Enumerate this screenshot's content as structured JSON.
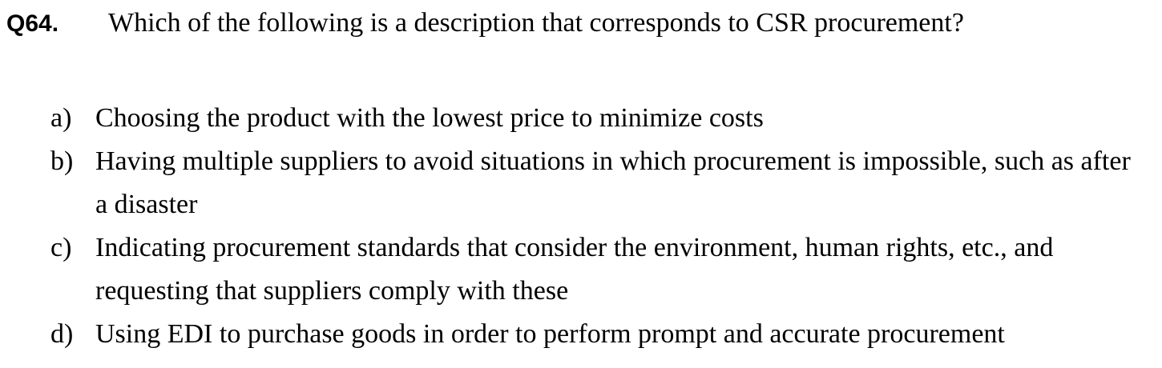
{
  "question": {
    "number": "Q64.",
    "text": "Which of the following is a description that corresponds to CSR procurement?"
  },
  "options": [
    {
      "letter": "a)",
      "text": "Choosing the product with the lowest price to minimize costs"
    },
    {
      "letter": "b)",
      "text": "Having multiple suppliers to avoid situations in which procurement is impossible, such as after a disaster"
    },
    {
      "letter": "c)",
      "text": "Indicating procurement standards that consider the environment, human rights, etc., and requesting that suppliers comply with these"
    },
    {
      "letter": "d)",
      "text": "Using EDI to purchase goods in order to perform prompt and accurate procurement"
    }
  ]
}
